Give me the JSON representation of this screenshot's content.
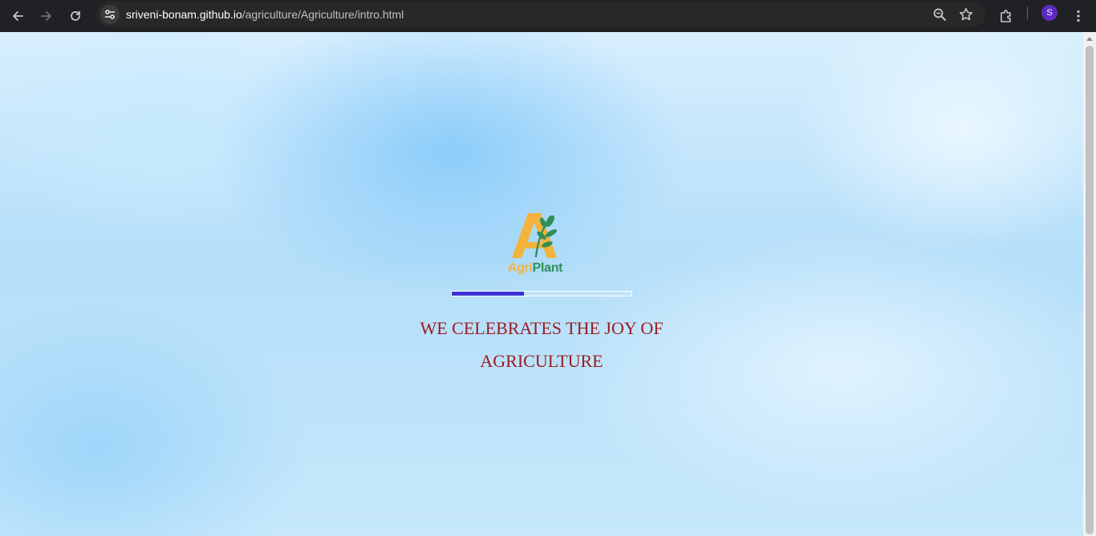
{
  "browser": {
    "url_host": "sriveni-bonam.github.io",
    "url_path": "/agriculture/Agriculture/intro.html",
    "profile_initial": "S",
    "icons": {
      "back": "arrow-left-icon",
      "forward": "arrow-right-icon",
      "reload": "reload-icon",
      "site_info": "tune-icon",
      "zoom": "magnifier-icon",
      "bookmark": "star-icon",
      "extensions": "puzzle-icon",
      "menu": "kebab-menu-icon"
    }
  },
  "page": {
    "logo": {
      "brand_part1": "Agri",
      "brand_part2": "Plant",
      "colors": {
        "letter": "#f4b33a",
        "leaves": "#2f8f5b"
      }
    },
    "loader": {
      "progress": 0.4,
      "fill_color": "#3b34d6"
    },
    "tagline": {
      "line1": "WE CELEBRATES THE JOY OF",
      "line2": "AGRICULTURE",
      "color": "#9b1c22"
    }
  }
}
